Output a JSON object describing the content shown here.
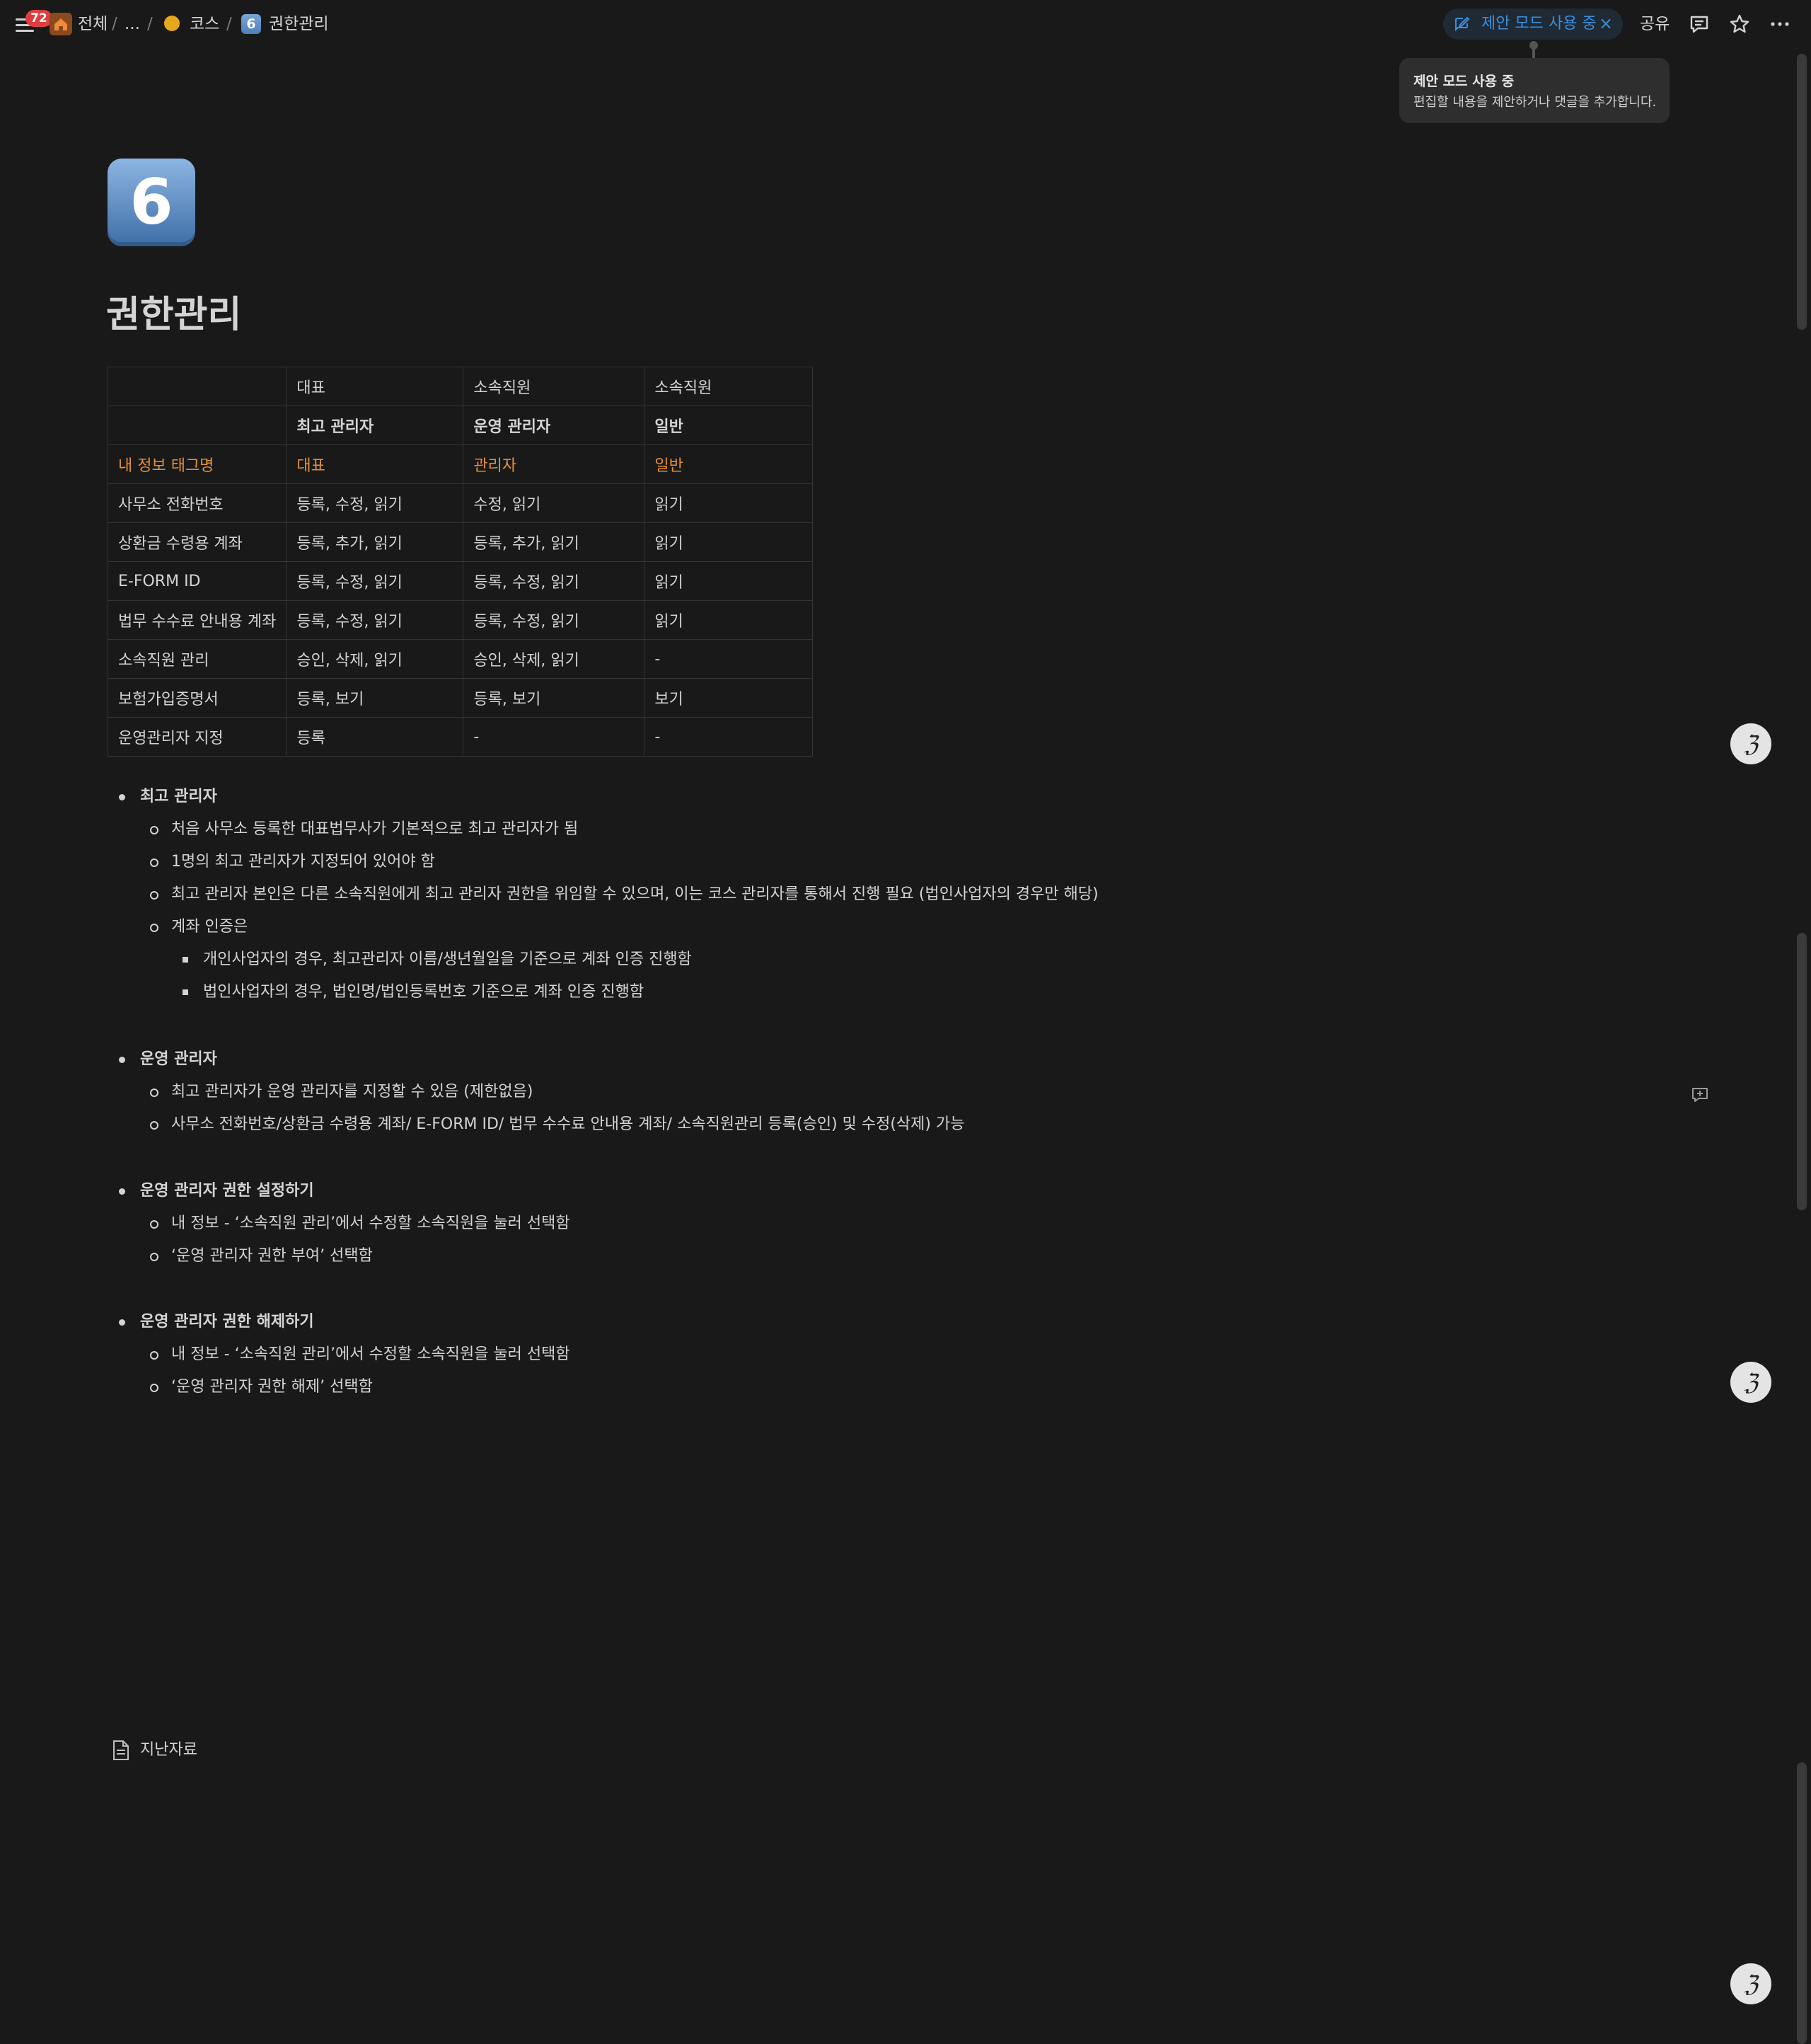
{
  "topbar": {
    "notification_count": "72",
    "breadcrumb": [
      "전체",
      "...",
      "코스",
      "권한관리"
    ],
    "breadcrumb_icon_number": "6",
    "suggest_mode_label": "제안 모드 사용 중",
    "close_glyph": "×",
    "share_label": "공유",
    "icons": [
      "menu-icon",
      "home-icon",
      "course-icon",
      "suggest-edit-icon",
      "comment-icon",
      "star-icon",
      "more-icon"
    ]
  },
  "tooltip": {
    "title": "제안 모드 사용 중",
    "description": "편집할 내용을 제안하거나 댓글을 추가합니다."
  },
  "page": {
    "icon_number": "6",
    "title": "권한관리"
  },
  "table": {
    "rows": [
      [
        "",
        "대표",
        "소속직원",
        "소속직원"
      ],
      [
        "",
        "최고 관리자",
        "운영 관리자",
        "일반"
      ],
      [
        "내 정보 태그명",
        "대표",
        "관리자",
        "일반"
      ],
      [
        "사무소 전화번호",
        "등록, 수정, 읽기",
        "수정, 읽기",
        "읽기"
      ],
      [
        "상환금 수령용 계좌",
        "등록, 추가, 읽기",
        "등록, 추가, 읽기",
        "읽기"
      ],
      [
        "E-FORM ID",
        "등록, 수정, 읽기",
        "등록, 수정, 읽기",
        "읽기"
      ],
      [
        "법무 수수료 안내용 계좌",
        "등록, 수정, 읽기",
        "등록, 수정, 읽기",
        "읽기"
      ],
      [
        "소속직원 관리",
        "승인, 삭제, 읽기",
        "승인, 삭제, 읽기",
        "-"
      ],
      [
        "보험가입증명서",
        "등록, 보기",
        "등록, 보기",
        "보기"
      ],
      [
        "운영관리자 지정",
        "등록",
        "-",
        "-"
      ]
    ],
    "highlight_color": "#e6903a"
  },
  "sections": [
    {
      "title": "최고 관리자",
      "items": [
        "처음 사무소 등록한 대표법무사가 기본적으로 최고 관리자가 됨",
        "1명의 최고 관리자가 지정되어 있어야 함",
        "최고 관리자 본인은 다른 소속직원에게 최고 관리자 권한을 위임할 수 있으며, 이는 코스 관리자를 통해서 진행 필요 (법인사업자의 경우만 해당)",
        "계좌 인증은"
      ],
      "subitems": [
        "개인사업자의 경우, 최고관리자 이름/생년월일을 기준으로 계좌 인증 진행함",
        "법인사업자의 경우, 법인명/법인등록번호 기준으로 계좌 인증 진행함"
      ]
    },
    {
      "title": "운영 관리자",
      "items": [
        "최고 관리자가 운영 관리자를 지정할 수 있음 (제한없음)",
        "사무소 전화번호/상환금 수령용 계좌/ E-FORM ID/ 법무 수수료 안내용 계좌/ 소속직원관리 등록(승인) 및 수정(삭제) 가능"
      ]
    },
    {
      "title": "운영 관리자 권한 설정하기",
      "items": [
        "내 정보 - ‘소속직원 관리’에서 수정할 소속직원을 눌러 선택함",
        "‘운영 관리자 권한 부여’ 선택함"
      ]
    },
    {
      "title": "운영 관리자 권한 해제하기",
      "items": [
        "내 정보 - ‘소속직원 관리’에서 수정할 소속직원을 눌러 선택함",
        "‘운영 관리자 권한 해제’ 선택함"
      ]
    }
  ],
  "subpage_link": {
    "label": "지난자료",
    "icon": "page-icon"
  },
  "avatar_glyph": "ℨ",
  "accent_color": "#3b8fdd"
}
